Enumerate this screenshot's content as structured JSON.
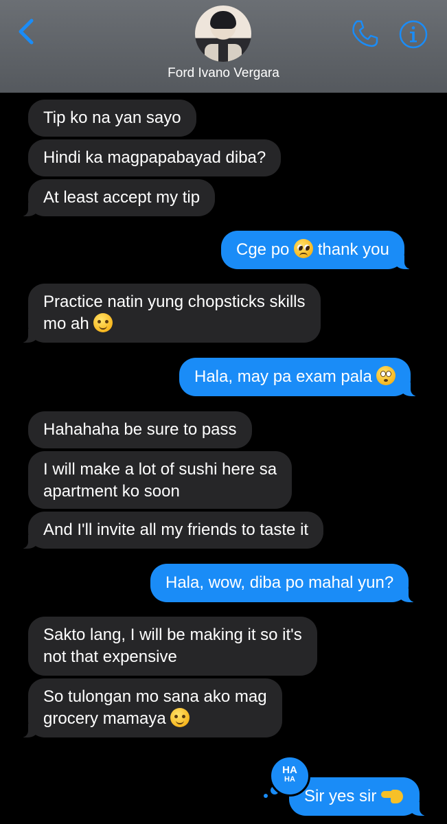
{
  "header": {
    "contact_name": "Ford Ivano Vergara",
    "accent_color": "#1a8cf7",
    "icons": [
      "chevron-left-icon",
      "phone-icon",
      "info-icon"
    ]
  },
  "messages": [
    {
      "from": "contact",
      "text": "Tip ko na yan sayo"
    },
    {
      "from": "contact",
      "text": "Hindi ka magpapabayad diba?"
    },
    {
      "from": "contact",
      "text": "At least accept my tip"
    },
    {
      "from": "me",
      "text_before": "Cge po ",
      "emoji": "pleading-face",
      "text_after": " thank you"
    },
    {
      "from": "contact",
      "line1": "Practice natin yung chopsticks skills",
      "line2": "mo ah ",
      "emoji": "smiling-face"
    },
    {
      "from": "me",
      "text": "Hala, may pa exam pala ",
      "emoji": "flushed-face"
    },
    {
      "from": "contact",
      "text": "Hahahaha be sure to pass"
    },
    {
      "from": "contact",
      "line1": "I will make a lot of  sushi here sa",
      "line2": "apartment ko soon"
    },
    {
      "from": "contact",
      "text": "And I'll invite all my friends to taste it"
    },
    {
      "from": "me",
      "text": "Hala, wow, diba po mahal yun?"
    },
    {
      "from": "contact",
      "line1": "Sakto lang, I will be making it so it's",
      "line2": "not that expensive"
    },
    {
      "from": "contact",
      "line1": "So tulongan mo sana ako mag",
      "line2": "grocery mamaya ",
      "emoji": "smiling-face"
    },
    {
      "from": "me",
      "text": "Sir yes sir ",
      "emoji": "saluting-hand",
      "reaction": {
        "line1": "HA",
        "line2": "HA"
      }
    }
  ],
  "colors": {
    "incoming_bubble": "#262628",
    "outgoing_bubble": "#1a8cf7",
    "background": "#000000"
  }
}
